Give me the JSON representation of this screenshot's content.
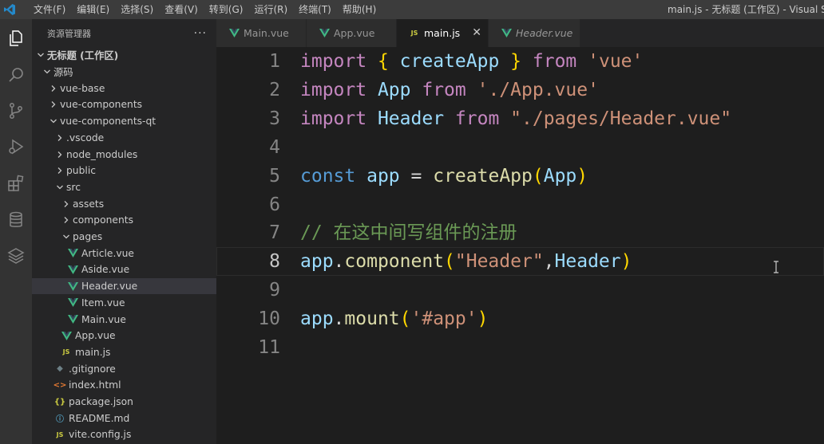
{
  "titlebar": {
    "menu": [
      "文件(F)",
      "编辑(E)",
      "选择(S)",
      "查看(V)",
      "转到(G)",
      "运行(R)",
      "终端(T)",
      "帮助(H)"
    ],
    "window_title": "main.js - 无标题 (工作区) - Visual Studi"
  },
  "activity_bar": {
    "icons": [
      "files-icon",
      "search-icon",
      "source-control-icon",
      "run-debug-icon",
      "extensions-icon",
      "database-icon",
      "remote-layers-icon"
    ]
  },
  "sidebar": {
    "title": "资源管理器",
    "more": "···",
    "workspace": "无标题 (工作区)",
    "tree": [
      {
        "label": "源码",
        "twisty": "open",
        "icon": ""
      },
      {
        "label": "vue-base",
        "twisty": "closed",
        "icon": ""
      },
      {
        "label": "vue-components",
        "twisty": "closed",
        "icon": ""
      },
      {
        "label": "vue-components-qt",
        "twisty": "open",
        "icon": ""
      },
      {
        "label": ".vscode",
        "twisty": "closed",
        "icon": ""
      },
      {
        "label": "node_modules",
        "twisty": "closed",
        "icon": ""
      },
      {
        "label": "public",
        "twisty": "closed",
        "icon": ""
      },
      {
        "label": "src",
        "twisty": "open",
        "icon": ""
      },
      {
        "label": "assets",
        "twisty": "closed",
        "icon": ""
      },
      {
        "label": "components",
        "twisty": "closed",
        "icon": ""
      },
      {
        "label": "pages",
        "twisty": "open",
        "icon": ""
      },
      {
        "label": "Article.vue",
        "twisty": "",
        "icon": "vue"
      },
      {
        "label": "Aside.vue",
        "twisty": "",
        "icon": "vue"
      },
      {
        "label": "Header.vue",
        "twisty": "",
        "icon": "vue",
        "selected": true
      },
      {
        "label": "Item.vue",
        "twisty": "",
        "icon": "vue"
      },
      {
        "label": "Main.vue",
        "twisty": "",
        "icon": "vue"
      },
      {
        "label": "App.vue",
        "twisty": "",
        "icon": "vue"
      },
      {
        "label": "main.js",
        "twisty": "",
        "icon": "js"
      },
      {
        "label": ".gitignore",
        "twisty": "",
        "icon": "git"
      },
      {
        "label": "index.html",
        "twisty": "",
        "icon": "html"
      },
      {
        "label": "package.json",
        "twisty": "",
        "icon": "json"
      },
      {
        "label": "README.md",
        "twisty": "",
        "icon": "md"
      },
      {
        "label": "vite.config.js",
        "twisty": "",
        "icon": "js"
      }
    ]
  },
  "tabs": [
    {
      "label": "Main.vue",
      "icon": "vue",
      "active": false,
      "italic": false
    },
    {
      "label": "App.vue",
      "icon": "vue",
      "active": false,
      "italic": false
    },
    {
      "label": "main.js",
      "icon": "js",
      "active": true,
      "italic": false,
      "close": "✕"
    },
    {
      "label": "Header.vue",
      "icon": "vue",
      "active": false,
      "italic": true
    }
  ],
  "icon_labels": {
    "js": "JS",
    "json": "{}",
    "html": "<>",
    "md": "ⓘ",
    "git": "◆"
  },
  "editor": {
    "language": "javascript",
    "current_line": 8,
    "lines": [
      {
        "n": "1",
        "text": "import { createApp } from 'vue'"
      },
      {
        "n": "2",
        "text": "import App from './App.vue'"
      },
      {
        "n": "3",
        "text": "import Header from \"./pages/Header.vue\""
      },
      {
        "n": "4",
        "text": ""
      },
      {
        "n": "5",
        "text": "const app = createApp(App)"
      },
      {
        "n": "6",
        "text": ""
      },
      {
        "n": "7",
        "text": "// 在这中间写组件的注册"
      },
      {
        "n": "8",
        "text": "app.component(\"Header\",Header)"
      },
      {
        "n": "9",
        "text": ""
      },
      {
        "n": "10",
        "text": "app.mount('#app')"
      },
      {
        "n": "11",
        "text": ""
      }
    ]
  },
  "colors": {
    "keyword": "#c586c0",
    "storage": "#569cd6",
    "variable": "#9cdcfe",
    "class": "#4ec9b0",
    "function": "#dcdcaa",
    "string": "#ce9178",
    "comment": "#6a9955",
    "bracket": "#ffd700",
    "accent": "#0e639c"
  }
}
